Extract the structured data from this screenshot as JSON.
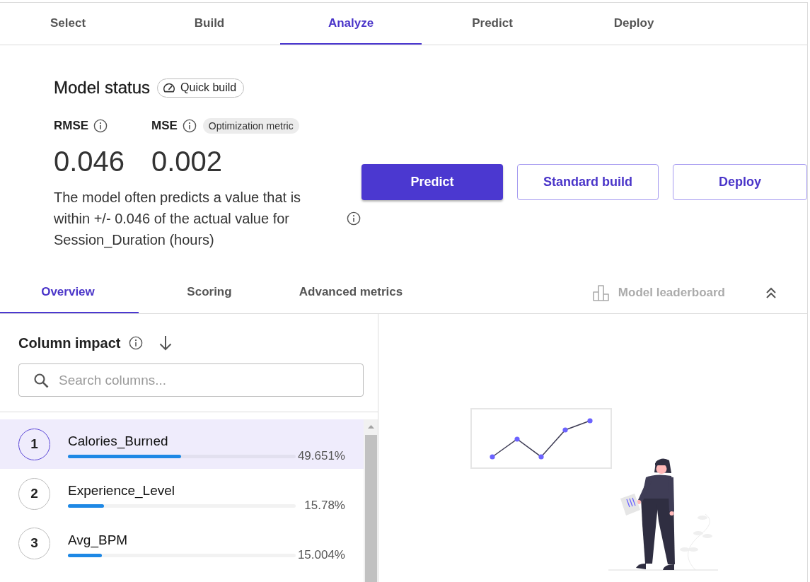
{
  "steps": [
    {
      "label": "Select",
      "selected": false
    },
    {
      "label": "Build",
      "selected": false
    },
    {
      "label": "Analyze",
      "selected": true
    },
    {
      "label": "Predict",
      "selected": false
    },
    {
      "label": "Deploy",
      "selected": false
    }
  ],
  "model_status": {
    "title": "Model status",
    "build_chip": "Quick build",
    "metrics": [
      {
        "name": "RMSE",
        "value": "0.046"
      },
      {
        "name": "MSE",
        "value": "0.002",
        "tag": "Optimization metric"
      }
    ],
    "description": "The model often predicts a value that is within +/- 0.046 of the actual value for Session_Duration (hours)"
  },
  "actions": [
    {
      "label": "Predict",
      "kind": "primary"
    },
    {
      "label": "Standard build",
      "kind": "secondary"
    },
    {
      "label": "Deploy",
      "kind": "secondary"
    }
  ],
  "result_tabs": [
    {
      "label": "Overview",
      "selected": true
    },
    {
      "label": "Scoring",
      "selected": false
    },
    {
      "label": "Advanced metrics",
      "selected": false
    }
  ],
  "leaderboard": {
    "label": "Model leaderboard",
    "disabled": true
  },
  "column_impact": {
    "title": "Column impact",
    "search": {
      "placeholder": "Search columns..."
    },
    "columns": [
      {
        "rank": "1",
        "name": "Calories_Burned",
        "level": 0.49651,
        "percent": "49.651%",
        "selected": true
      },
      {
        "rank": "2",
        "name": "Experience_Level",
        "level": 0.1578,
        "percent": "15.78%",
        "selected": false
      },
      {
        "rank": "3",
        "name": "Avg_BPM",
        "level": 0.15004,
        "percent": "15.004%",
        "selected": false
      }
    ]
  }
}
